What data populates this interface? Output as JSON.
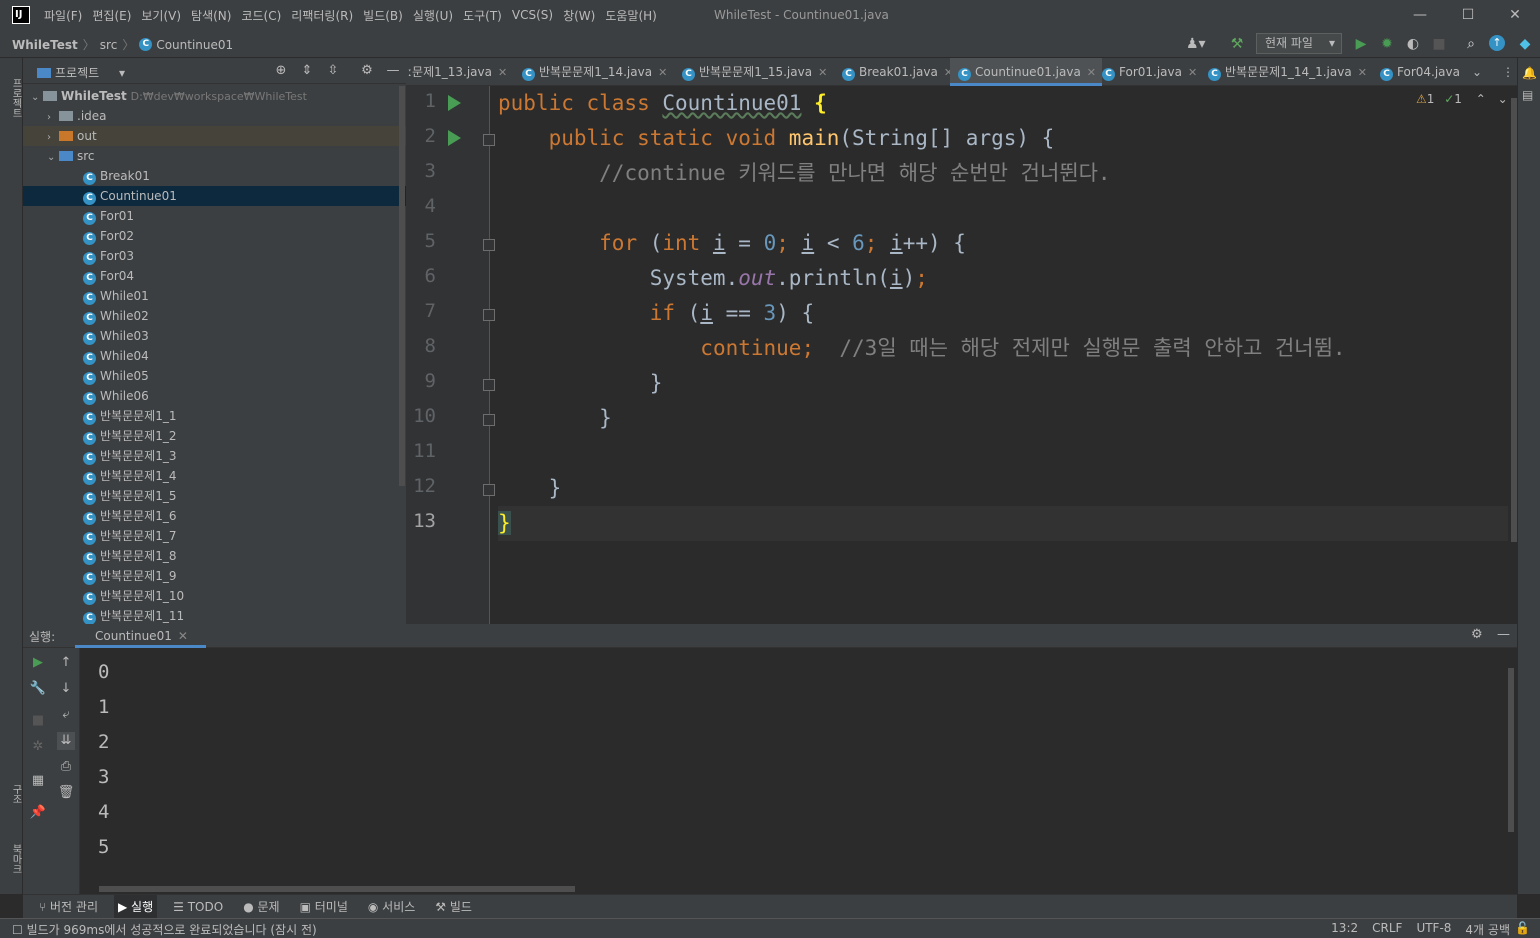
{
  "titlebar": {
    "logo": "IJ",
    "menu": [
      "파일(F)",
      "편집(E)",
      "보기(V)",
      "탐색(N)",
      "코드(C)",
      "리팩터링(R)",
      "빌드(B)",
      "실행(U)",
      "도구(T)",
      "VCS(S)",
      "창(W)",
      "도움말(H)"
    ],
    "title": "WhileTest - Countinue01.java",
    "minimize": "—",
    "maximize": "☐",
    "close": "✕"
  },
  "navbar": {
    "crumbs": [
      "WhileTest",
      "src",
      "Countinue01"
    ],
    "run_config": "현재 파일"
  },
  "leftstrip": {
    "project_label": "프로젝트",
    "structure_label": "구조",
    "bookmarks_label": "북마크"
  },
  "project": {
    "title": "프로젝트",
    "root": {
      "name": "WhileTest",
      "path": "D:₩dev₩workspace₩WhileTest"
    },
    "folders": [
      ".idea",
      "out",
      "src"
    ],
    "files": [
      "Break01",
      "Countinue01",
      "For01",
      "For02",
      "For03",
      "For04",
      "While01",
      "While02",
      "While03",
      "While04",
      "While05",
      "While06",
      "반복문문제1_1",
      "반복문문제1_2",
      "반복문문제1_3",
      "반복문문제1_4",
      "반복문문제1_5",
      "반복문문제1_6",
      "반복문문제1_7",
      "반복문문제1_8",
      "반복문문제1_9",
      "반복문문제1_10",
      "반복문문제1_11"
    ]
  },
  "tabs": [
    "ː문제1_13.java",
    "반복문문제1_14.java",
    "반복문문제1_15.java",
    "Break01.java",
    "Countinue01.java",
    "For01.java",
    "반복문문제1_14_1.java",
    "For04.java"
  ],
  "active_tab": "Countinue01.java",
  "inspections": {
    "warnings": "1",
    "weak_warnings": "1"
  },
  "editor": {
    "line_numbers": [
      "1",
      "2",
      "3",
      "4",
      "5",
      "6",
      "7",
      "8",
      "9",
      "10",
      "11",
      "12",
      "13"
    ],
    "comment1": "//continue 키워드를 만나면 해당 순번만 건너뛴다.",
    "comment2": "//3일 때는 해당 전제만 실행문 출력 안하고 건너뜀.",
    "class_name": "Countinue01"
  },
  "run": {
    "label": "실행:",
    "tab": "Countinue01",
    "output": [
      "0",
      "1",
      "2",
      "3",
      "4",
      "5"
    ]
  },
  "bottom_tabs": [
    "버전 관리",
    "실행",
    "TODO",
    "문제",
    "터미널",
    "서비스",
    "빌드"
  ],
  "status": {
    "message": "빌드가 969ms에서 성공적으로 완료되었습니다 (잠시 전)",
    "position": "13:2",
    "line_sep": "CRLF",
    "encoding": "UTF-8",
    "indent": "4개 공백"
  },
  "colors": {
    "keyword": "#cc7832",
    "function": "#ffc66d",
    "number": "#6897bb",
    "comment": "#808080",
    "accent": "#4a88c7",
    "run": "#499c54"
  }
}
